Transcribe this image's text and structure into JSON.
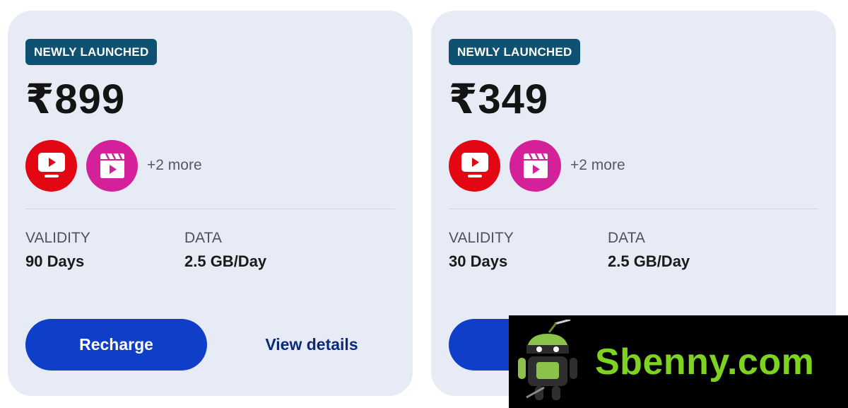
{
  "plans": [
    {
      "badge": "NEWLY LAUNCHED",
      "price": "₹899",
      "ott_icons": [
        "tv-play-icon",
        "clapperboard-play-icon"
      ],
      "more": "+2 more",
      "validity_label": "VALIDITY",
      "validity_value": "90 Days",
      "data_label": "DATA",
      "data_value": "2.5 GB/Day",
      "recharge_label": "Recharge",
      "view_details_label": "View details"
    },
    {
      "badge": "NEWLY LAUNCHED",
      "price": "₹349",
      "ott_icons": [
        "tv-play-icon",
        "clapperboard-play-icon"
      ],
      "more": "+2 more",
      "validity_label": "VALIDITY",
      "validity_value": "30 Days",
      "data_label": "DATA",
      "data_value": "2.5 GB/Day",
      "recharge_label": "R",
      "view_details_label": ""
    }
  ],
  "watermark": {
    "text": "Sbenny.com",
    "logo_icon": "android-ninja-icon"
  },
  "colors": {
    "card_bg": "#e7ebf6",
    "badge_bg": "#0f5173",
    "recharge_bg": "#0f3fc8",
    "view_details": "#0c2a7a",
    "tv_icon_bg": "#e30613",
    "cinema_icon_bg": "#d4219a",
    "watermark_text": "#7ed321"
  }
}
